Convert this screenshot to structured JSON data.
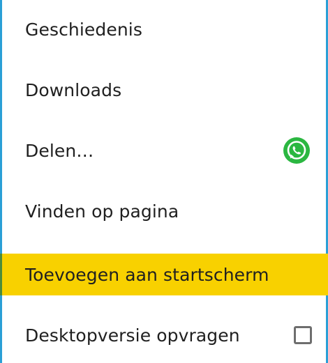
{
  "menu": {
    "items": [
      {
        "label": "Geschiedenis"
      },
      {
        "label": "Downloads"
      },
      {
        "label": "Delen…",
        "trailing_icon": "whatsapp-icon"
      },
      {
        "label": "Vinden op pagina"
      },
      {
        "label": "Toevoegen aan startscherm",
        "highlighted": true
      },
      {
        "label": "Desktopversie opvragen",
        "trailing_control": "checkbox",
        "checked": false
      }
    ]
  },
  "colors": {
    "highlight": "#f8d100",
    "border": "#2a9fd6",
    "whatsapp": "#25d366"
  }
}
